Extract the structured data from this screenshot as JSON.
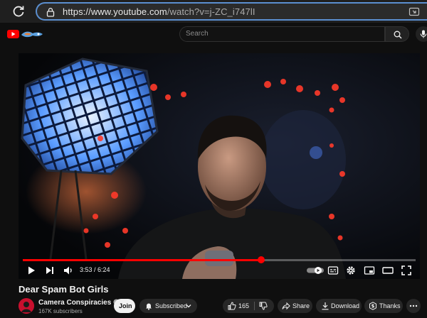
{
  "browser": {
    "url_host": "https://www.youtube.com",
    "url_path": "/watch?v=j-ZC_i747lI"
  },
  "header": {
    "search_placeholder": "Search"
  },
  "player": {
    "time_current": "3:53",
    "time_total": "6:24",
    "progress": 0.607,
    "accent": "#ff0000"
  },
  "video": {
    "title": "Dear Spam Bot Girls"
  },
  "channel": {
    "name": "Camera Conspiracies",
    "subscribers": "167K subscribers",
    "avatar_color": "#c8102e"
  },
  "actions": {
    "join": "Join",
    "subscribed": "Subscribed",
    "likes": "165",
    "share": "Share",
    "download": "Download",
    "thanks": "Thanks"
  }
}
